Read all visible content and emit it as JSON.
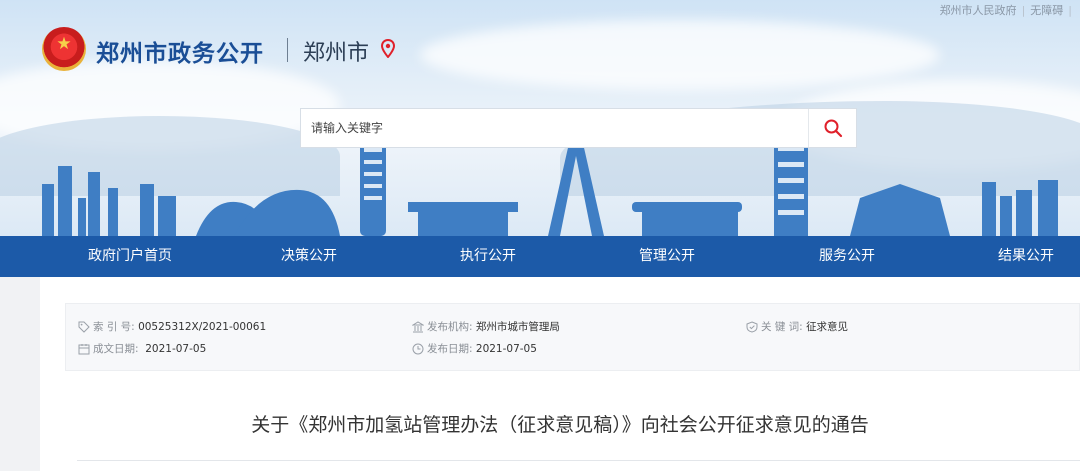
{
  "header": {
    "top_links": [
      "郑州市人民政府",
      "无障碍"
    ],
    "site_title": "郑州市政务公开",
    "city": "郑州市"
  },
  "search": {
    "placeholder": "请输入关键字"
  },
  "icons": {
    "search": "search-icon",
    "location": "location-pin-icon",
    "emblem": "national-emblem-icon"
  },
  "colors": {
    "nav_bg": "#1c5aa8",
    "title": "#1a4e96",
    "pin": "#e0202a",
    "search_icon": "#e0202a"
  },
  "nav": [
    "政府门户首页",
    "决策公开",
    "执行公开",
    "管理公开",
    "服务公开",
    "结果公开"
  ],
  "meta": {
    "index_label": "索 引 号:",
    "index_value": "00525312X/2021-00061",
    "publisher_label": "发布机构:",
    "publisher_value": "郑州市城市管理局",
    "keywords_label": "关 键 词:",
    "keywords_value": "征求意见",
    "created_label": "成文日期:",
    "created_value": "2021-07-05",
    "published_label": "发布日期:",
    "published_value": "2021-07-05"
  },
  "document": {
    "title": "关于《郑州市加氢站管理办法（征求意见稿）》向社会公开征求意见的通告"
  }
}
